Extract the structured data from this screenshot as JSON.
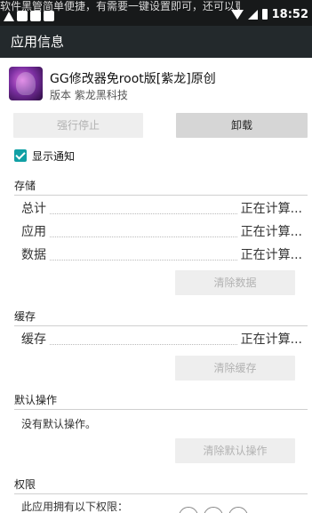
{
  "status_bar": {
    "notification_text": "软件黑管简单便捷，有需要一键设置即可，还可以更好的控",
    "time": "18:52"
  },
  "action_bar": {
    "title": "应用信息"
  },
  "app": {
    "name": "GG修改器免root版[紫龙]原创",
    "version_line": "版本 紫龙黑科技",
    "icon_name": "app-icon"
  },
  "buttons": {
    "force_stop": "强行停止",
    "uninstall": "卸载",
    "clear_data": "清除数据",
    "clear_cache": "清除缓存",
    "clear_defaults": "清除默认操作"
  },
  "notify": {
    "label": "显示通知",
    "checked": true
  },
  "storage": {
    "title": "存储",
    "rows": [
      {
        "label": "总计",
        "value": "正在计算..."
      },
      {
        "label": "应用",
        "value": "正在计算..."
      },
      {
        "label": "数据",
        "value": "正在计算..."
      }
    ]
  },
  "cache": {
    "title": "缓存",
    "rows": [
      {
        "label": "缓存",
        "value": "正在计算..."
      }
    ]
  },
  "defaults": {
    "title": "默认操作",
    "text": "没有默认操作。"
  },
  "permissions": {
    "title": "权限",
    "text": "此应用拥有以下权限："
  },
  "colors": {
    "status_bar": "#17191a",
    "action_bar": "#23292c",
    "accent": "#11a0a5"
  }
}
